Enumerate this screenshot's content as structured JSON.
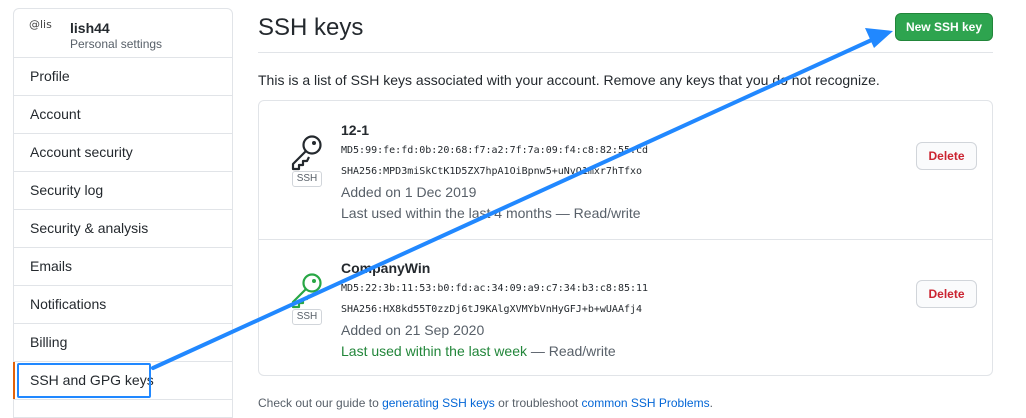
{
  "sidebar": {
    "avatar_alt": "@lis",
    "username": "lish44",
    "subtitle": "Personal settings",
    "items": [
      {
        "label": "Profile"
      },
      {
        "label": "Account"
      },
      {
        "label": "Account security"
      },
      {
        "label": "Security log"
      },
      {
        "label": "Security & analysis"
      },
      {
        "label": "Emails"
      },
      {
        "label": "Notifications"
      },
      {
        "label": "Billing"
      },
      {
        "label": "SSH and GPG keys"
      }
    ]
  },
  "main": {
    "title": "SSH keys",
    "new_key_button": "New SSH key",
    "intro": "This is a list of SSH keys associated with your account. Remove any keys that you do not recognize.",
    "keys": [
      {
        "title": "12-1",
        "md5": "MD5:99:fe:fd:0b:20:68:f7:a2:7f:7a:09:f4:c8:82:55:cd",
        "sha256": "SHA256:MPD3miSkCtK1D5ZX7hpA1OiBpnw5+uNvQ1mxr7hTfxo",
        "added": "Added on 1 Dec 2019",
        "last_used": "Last used within the last 4 months — Read/write",
        "badge": "SSH",
        "delete": "Delete",
        "icon_color": "#24292e"
      },
      {
        "title": "CompanyWin",
        "md5": "MD5:22:3b:11:53:b0:fd:ac:34:09:a9:c7:34:b3:c8:85:11",
        "sha256": "SHA256:HX8kd55T0zzDj6tJ9KAlgXVMYbVnHyGFJ+b+wUAAfj4",
        "added": "Added on 21 Sep 2020",
        "last_used_recent": "Last used within the last week",
        "last_used_rest": " — Read/write",
        "badge": "SSH",
        "delete": "Delete",
        "icon_color": "#28a745"
      }
    ],
    "footer": {
      "pre": "Check out our guide to ",
      "link1": "generating SSH keys",
      "mid": " or troubleshoot ",
      "link2": "common SSH Problems",
      "post": "."
    }
  },
  "colors": {
    "accent": "#2ea44f",
    "annotation": "#2188ff",
    "danger": "#cb2431",
    "link": "#0366d6"
  }
}
